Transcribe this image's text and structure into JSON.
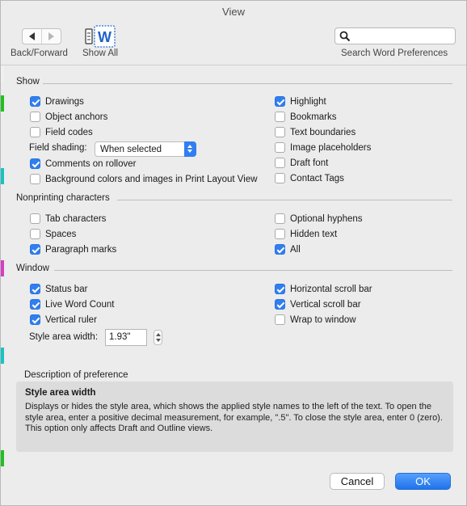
{
  "window": {
    "title": "View"
  },
  "toolbar": {
    "back_forward_label": "Back/Forward",
    "show_all_label": "Show All",
    "search_placeholder": "",
    "search_label": "Search Word Preferences"
  },
  "show": {
    "title": "Show",
    "left": [
      {
        "label": "Drawings",
        "checked": true
      },
      {
        "label": "Object anchors",
        "checked": false
      },
      {
        "label": "Field codes",
        "checked": false
      }
    ],
    "field_shading_label": "Field shading:",
    "field_shading_value": "When selected",
    "left2": [
      {
        "label": "Comments on rollover",
        "checked": true
      },
      {
        "label": "Background colors and images in Print Layout View",
        "checked": false
      }
    ],
    "right": [
      {
        "label": "Highlight",
        "checked": true
      },
      {
        "label": "Bookmarks",
        "checked": false
      },
      {
        "label": "Text boundaries",
        "checked": false
      },
      {
        "label": "Image placeholders",
        "checked": false
      },
      {
        "label": "Draft font",
        "checked": false
      },
      {
        "label": "Contact Tags",
        "checked": false
      }
    ]
  },
  "nonprinting": {
    "title": "Nonprinting characters",
    "left": [
      {
        "label": "Tab characters",
        "checked": false
      },
      {
        "label": "Spaces",
        "checked": false
      },
      {
        "label": "Paragraph marks",
        "checked": true
      }
    ],
    "right": [
      {
        "label": "Optional hyphens",
        "checked": false
      },
      {
        "label": "Hidden text",
        "checked": false
      },
      {
        "label": "All",
        "checked": true
      }
    ]
  },
  "window_section": {
    "title": "Window",
    "left": [
      {
        "label": "Status bar",
        "checked": true
      },
      {
        "label": "Live Word Count",
        "checked": true
      },
      {
        "label": "Vertical ruler",
        "checked": true
      }
    ],
    "right": [
      {
        "label": "Horizontal scroll bar",
        "checked": true
      },
      {
        "label": "Vertical scroll bar",
        "checked": true
      },
      {
        "label": "Wrap to window",
        "checked": false
      }
    ],
    "style_area_label": "Style area width:",
    "style_area_value": "1.93\""
  },
  "description": {
    "label": "Description of preference",
    "title": "Style area width",
    "body": "Displays or hides the style area, which shows the applied style names to the left of the text. To open the style area, enter a positive decimal measurement, for example, \".5\". To close the style area, enter 0 (zero). This option only affects Draft and Outline views."
  },
  "buttons": {
    "cancel": "Cancel",
    "ok": "OK"
  },
  "colors": {
    "accent": "#2f7ff0",
    "background": "#ececec",
    "description_bg": "#dcdcdc"
  }
}
